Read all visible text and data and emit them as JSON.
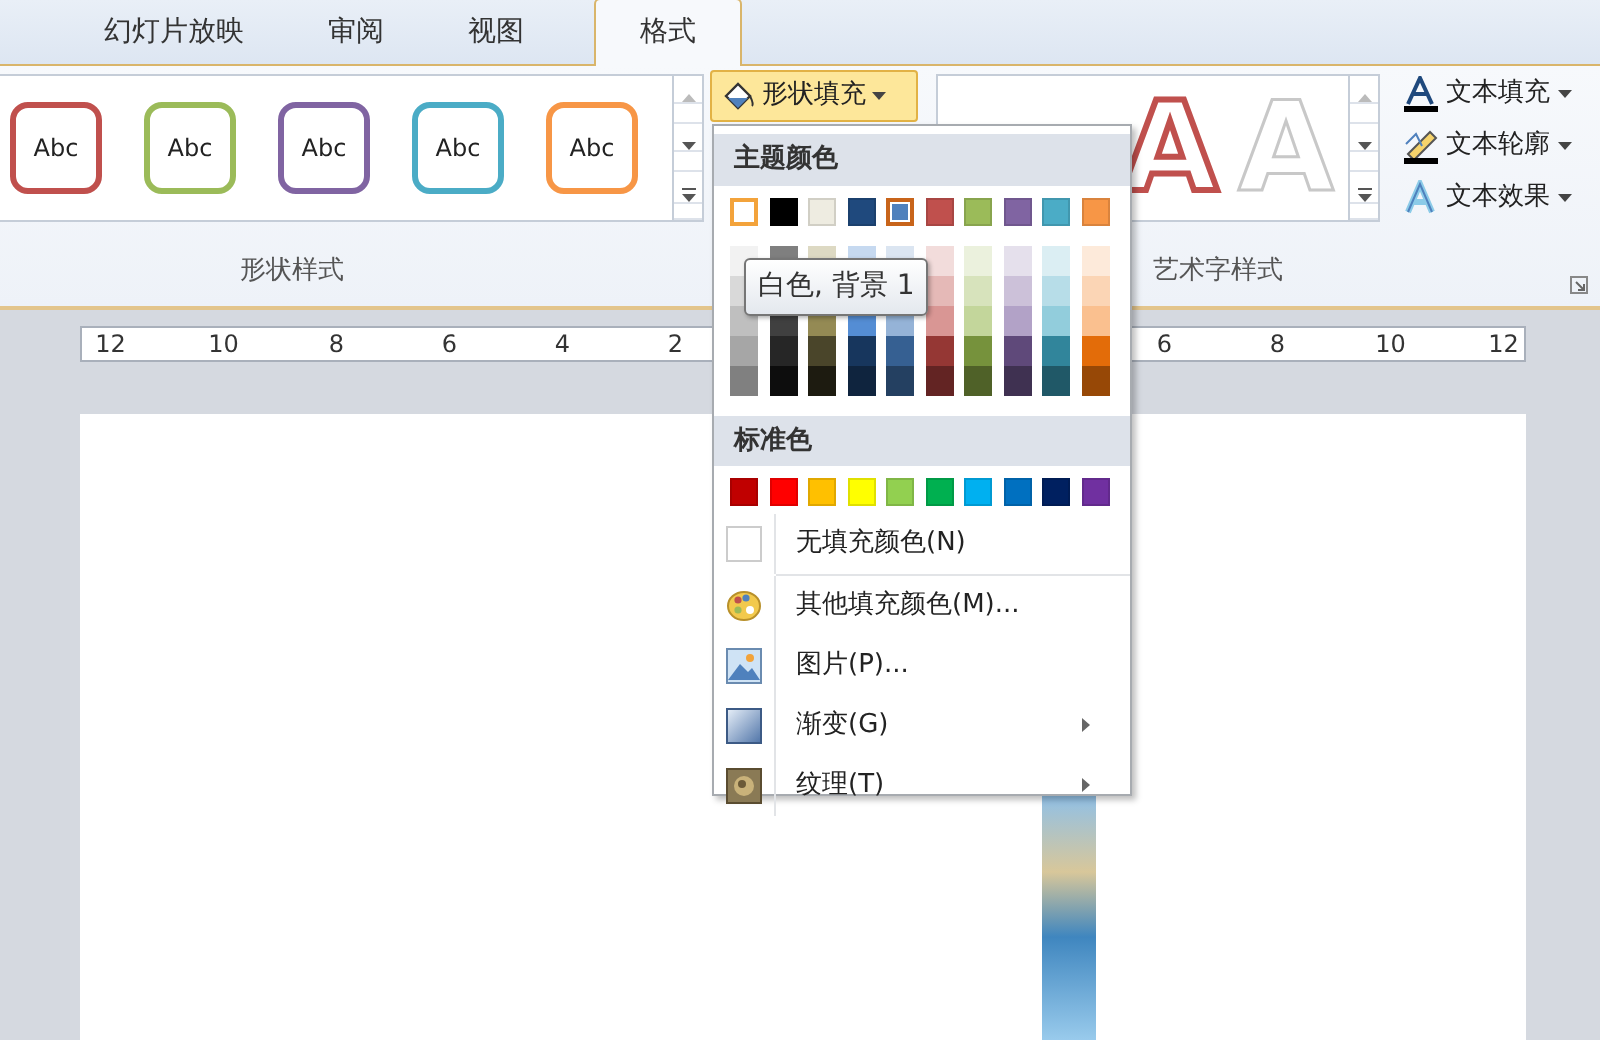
{
  "tabs": [
    {
      "label": "幻灯片放映",
      "selected": false
    },
    {
      "label": "审阅",
      "selected": false
    },
    {
      "label": "视图",
      "selected": false
    },
    {
      "label": "格式",
      "selected": true
    }
  ],
  "ribbon": {
    "shape_styles": {
      "items": [
        {
          "label": "Abc",
          "color": "#c0504d"
        },
        {
          "label": "Abc",
          "color": "#9bbb59"
        },
        {
          "label": "Abc",
          "color": "#8064a2"
        },
        {
          "label": "Abc",
          "color": "#4bacc6"
        },
        {
          "label": "Abc",
          "color": "#f79646"
        }
      ],
      "group_label": "形状样式"
    },
    "shape_fill_button": {
      "label": "形状填充",
      "active": true
    },
    "wordart_styles": {
      "items": [
        {
          "label": "A",
          "kind": "red-outline"
        },
        {
          "label": "A",
          "kind": "white-outline"
        }
      ],
      "group_label": "艺术字样式"
    },
    "text_buttons": [
      {
        "label": "文本填充",
        "kind": "fill"
      },
      {
        "label": "文本轮廓",
        "kind": "outline"
      },
      {
        "label": "文本效果",
        "kind": "effects"
      }
    ]
  },
  "ruler": {
    "left_numbers": [
      "12",
      "10",
      "8",
      "6",
      "4",
      "2"
    ],
    "right_numbers": [
      "6",
      "8",
      "10",
      "12"
    ]
  },
  "fill_menu": {
    "theme_header": "主题颜色",
    "theme_colors": [
      {
        "color": "#ffffff",
        "selected": false,
        "hovered": true,
        "shades": [
          {
            "color": "#f2f2f2"
          },
          {
            "color": "#d9d9d9"
          },
          {
            "color": "#bfbfbf"
          },
          {
            "color": "#a6a6a6"
          },
          {
            "color": "#808080"
          }
        ]
      },
      {
        "color": "#000000",
        "selected": false,
        "hovered": false,
        "shades": [
          {
            "color": "#7f7f7f"
          },
          {
            "color": "#404040"
          },
          {
            "color": "#262626"
          },
          {
            "color": "#0d0d0d"
          }
        ]
      },
      {
        "color": "#eeece1",
        "selected": false,
        "hovered": false,
        "shades": [
          {
            "color": "#ddd9c3"
          },
          {
            "color": "#948a54"
          },
          {
            "color": "#4a452a"
          },
          {
            "color": "#1d1b10"
          }
        ]
      },
      {
        "color": "#1f497d",
        "selected": false,
        "hovered": false,
        "shades": [
          {
            "color": "#c6d9f0"
          },
          {
            "color": "#548dd4"
          },
          {
            "color": "#17365d"
          },
          {
            "color": "#0f243e"
          }
        ]
      },
      {
        "color": "#4f81bd",
        "selected": true,
        "hovered": false,
        "shades": [
          {
            "color": "#dbe5f1"
          },
          {
            "color": "#95b3d7"
          },
          {
            "color": "#366092"
          },
          {
            "color": "#244061"
          }
        ]
      },
      {
        "color": "#c0504d",
        "selected": false,
        "hovered": false,
        "shades": [
          {
            "color": "#f2dcdb"
          },
          {
            "color": "#e5b9b7"
          },
          {
            "color": "#d99694"
          },
          {
            "color": "#953734"
          },
          {
            "color": "#632423"
          }
        ]
      },
      {
        "color": "#9bbb59",
        "selected": false,
        "hovered": false,
        "shades": [
          {
            "color": "#ebf1dd"
          },
          {
            "color": "#d7e3bc"
          },
          {
            "color": "#c3d69b"
          },
          {
            "color": "#76923c"
          },
          {
            "color": "#4f6128"
          }
        ]
      },
      {
        "color": "#8064a2",
        "selected": false,
        "hovered": false,
        "shades": [
          {
            "color": "#e5e0ec"
          },
          {
            "color": "#ccc1d9"
          },
          {
            "color": "#b2a2c7"
          },
          {
            "color": "#5f497a"
          },
          {
            "color": "#3f3151"
          }
        ]
      },
      {
        "color": "#4bacc6",
        "selected": false,
        "hovered": false,
        "shades": [
          {
            "color": "#dbeef3"
          },
          {
            "color": "#b7dde8"
          },
          {
            "color": "#92cddc"
          },
          {
            "color": "#31859b"
          },
          {
            "color": "#205867"
          }
        ]
      },
      {
        "color": "#f79646",
        "selected": false,
        "hovered": false,
        "shades": [
          {
            "color": "#fdeada"
          },
          {
            "color": "#fbd5b5"
          },
          {
            "color": "#fac08f"
          },
          {
            "color": "#e36c09"
          },
          {
            "color": "#974806"
          }
        ]
      }
    ],
    "tooltip": "白色, 背景 1",
    "standard_header": "标准色",
    "standard_colors": [
      {
        "color": "#c00000"
      },
      {
        "color": "#ff0000"
      },
      {
        "color": "#ffc000"
      },
      {
        "color": "#ffff00"
      },
      {
        "color": "#92d050"
      },
      {
        "color": "#00b050"
      },
      {
        "color": "#00b0f0"
      },
      {
        "color": "#0070c0"
      },
      {
        "color": "#002060"
      },
      {
        "color": "#7030a0"
      }
    ],
    "items": [
      {
        "kind": "no-fill",
        "label": "无填充颜色(N)",
        "submenu": false
      },
      {
        "kind": "more-colors",
        "label": "其他填充颜色(M)...",
        "submenu": false
      },
      {
        "kind": "picture",
        "label": "图片(P)...",
        "submenu": false
      },
      {
        "kind": "gradient",
        "label": "渐变(G)",
        "submenu": true
      },
      {
        "kind": "texture",
        "label": "纹理(T)",
        "submenu": true
      }
    ]
  }
}
